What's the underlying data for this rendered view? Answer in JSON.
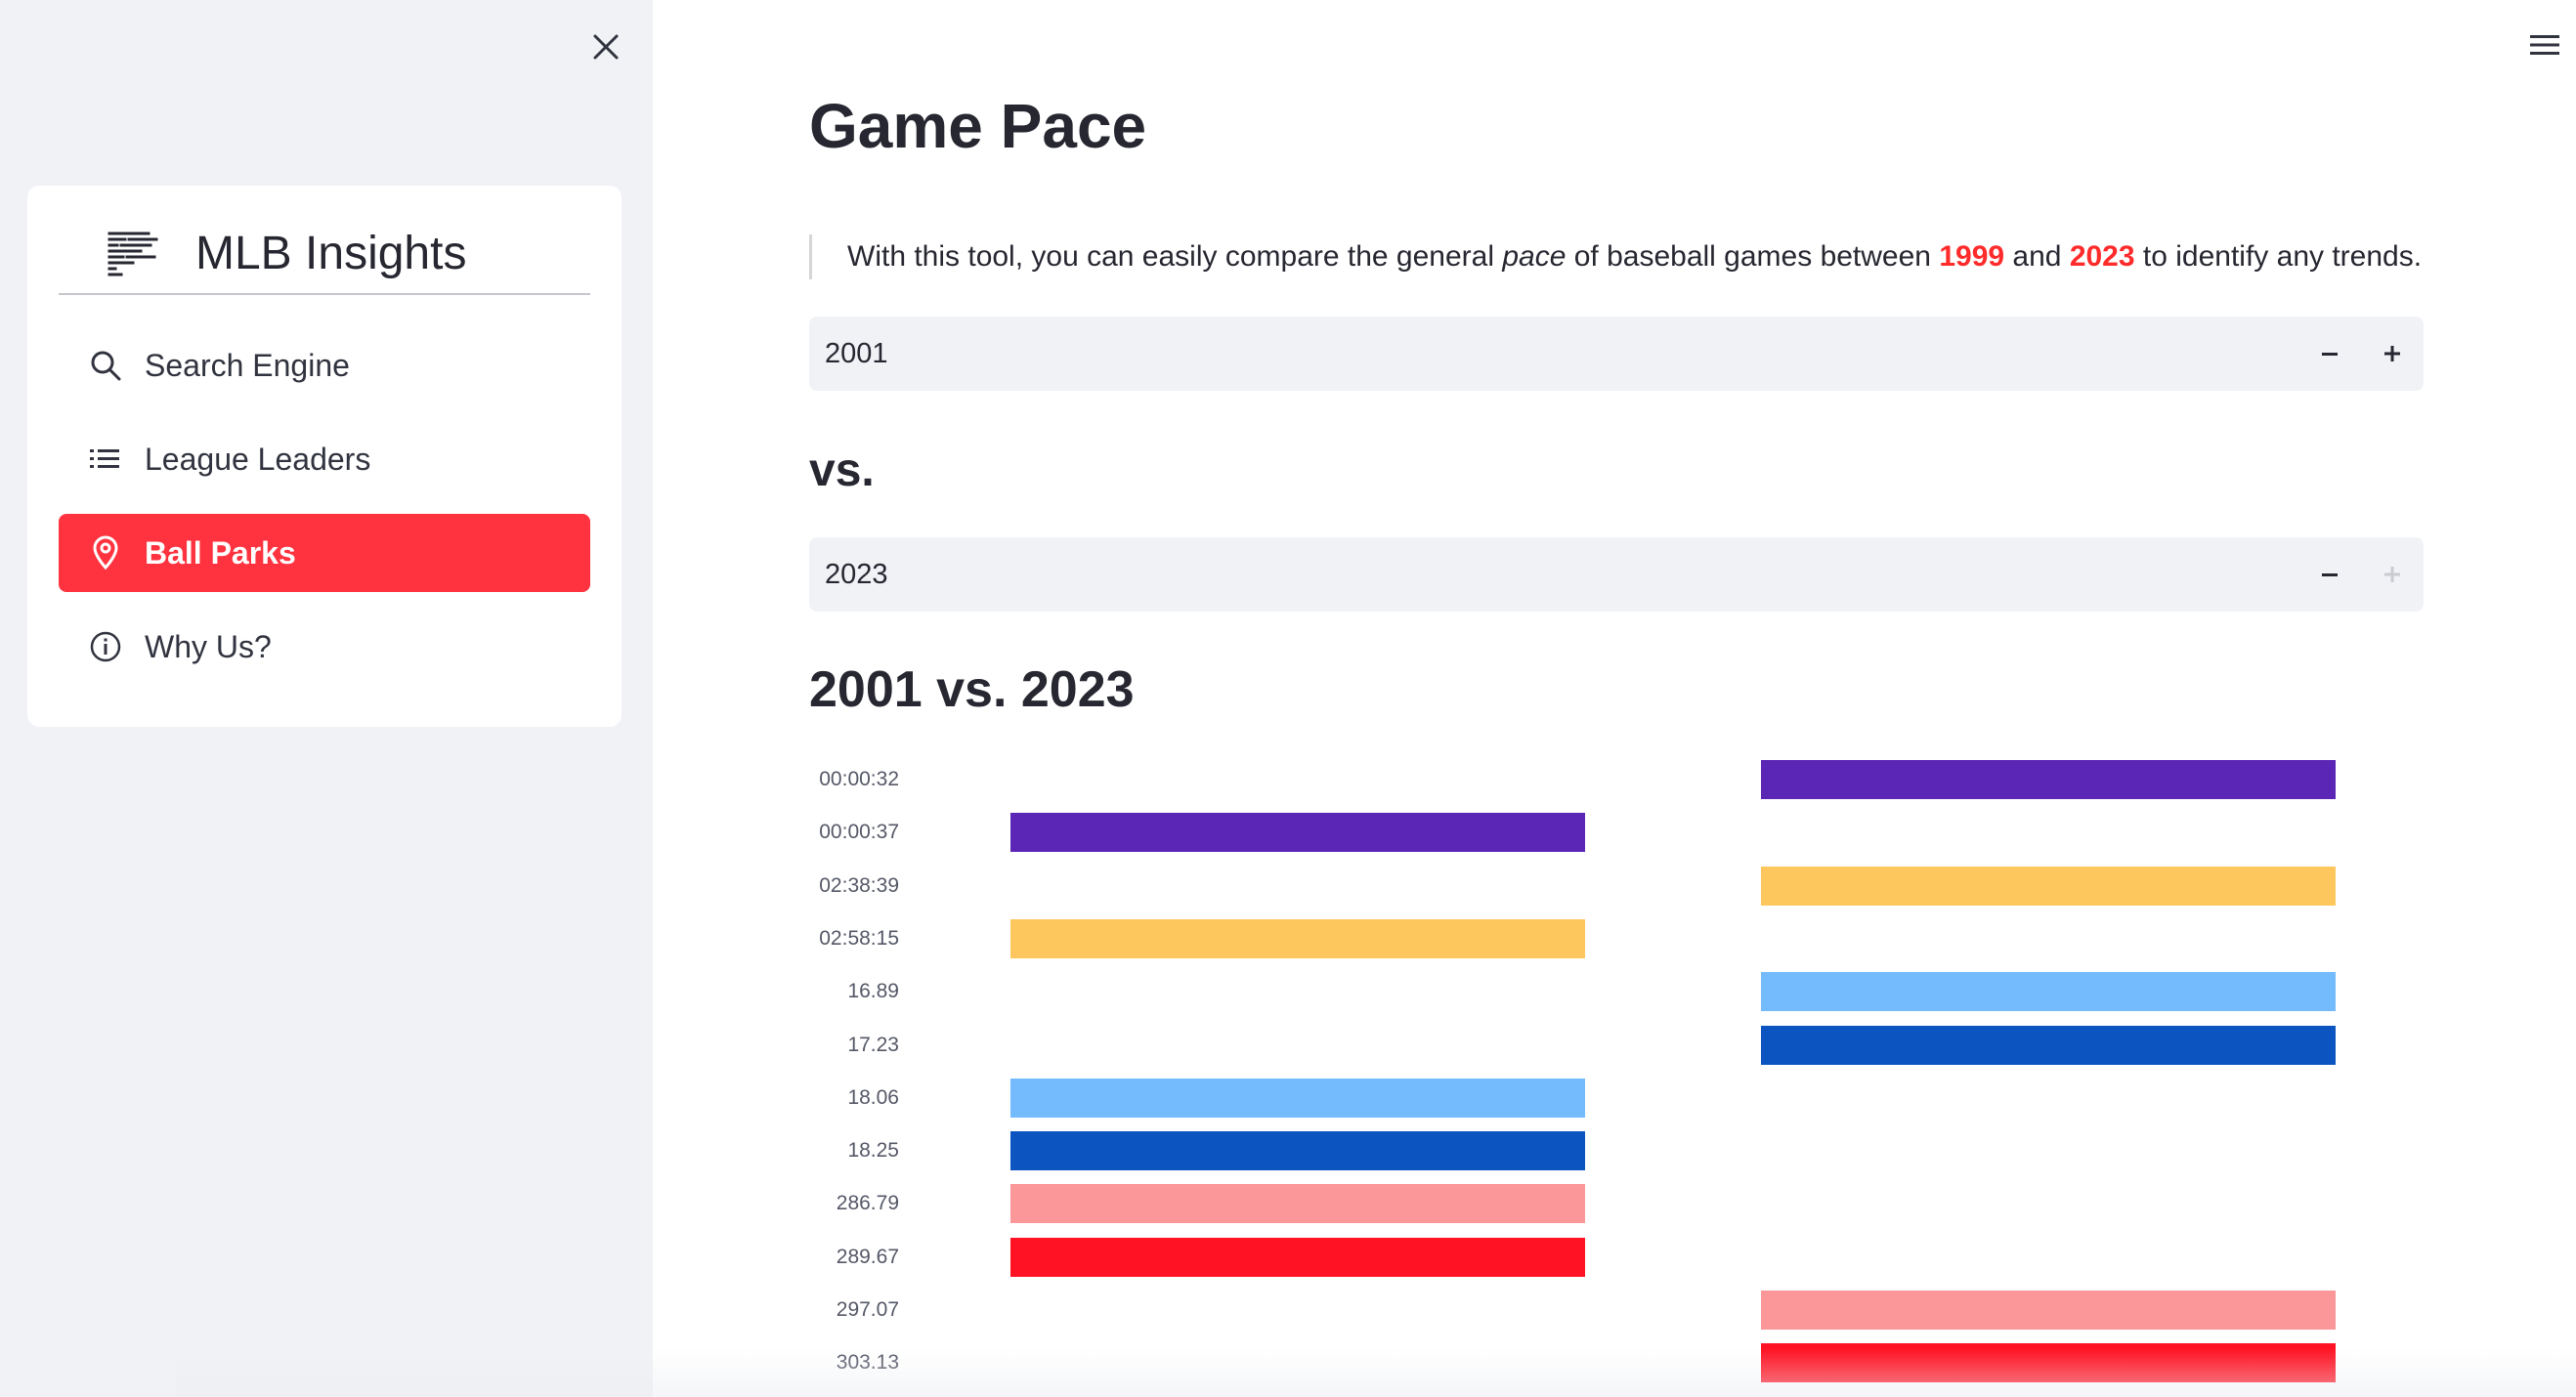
{
  "sidebar": {
    "app_title": "MLB Insights",
    "items": [
      {
        "label": "Search Engine",
        "icon": "search-icon",
        "active": false
      },
      {
        "label": "League Leaders",
        "icon": "list-icon",
        "active": false
      },
      {
        "label": "Ball Parks",
        "icon": "map-pin-icon",
        "active": true
      },
      {
        "label": "Why Us?",
        "icon": "info-icon",
        "active": false
      }
    ]
  },
  "main": {
    "title": "Game Pace",
    "intro": {
      "before": "With this tool, you can easily compare the general ",
      "emphasis": "pace",
      "middle": " of baseball games between ",
      "year_start": "1999",
      "and": " and ",
      "year_end": "2023",
      "after": " to identify any trends."
    },
    "stepper_1": {
      "value": "2001",
      "minus": "−",
      "plus": "+"
    },
    "vs_label": "vs.",
    "stepper_2": {
      "value": "2023",
      "minus": "−",
      "plus": "+"
    },
    "comparison_title": "2001 vs. 2023"
  },
  "colors": {
    "accent": "#ff333f",
    "highlight": "#ff2b2b",
    "sidebar_bg": "#f0f2f6"
  },
  "chart_data": {
    "type": "bar",
    "categories": [
      "00:00:32",
      "00:00:37",
      "02:38:39",
      "02:58:15",
      "16.89",
      "17.23",
      "18.06",
      "18.25",
      "286.79",
      "289.67",
      "297.07",
      "303.13"
    ],
    "series": [
      {
        "values": [
          null,
          1,
          null,
          1,
          null,
          null,
          1,
          1,
          1,
          1,
          null,
          null
        ],
        "colors": [
          null,
          "#5b25b5",
          null,
          "#fec75d",
          null,
          null,
          "#73bbfd",
          "#0c54bf",
          "#fb9699",
          "#ff1223",
          null,
          null
        ]
      },
      {
        "values": [
          1,
          null,
          1,
          null,
          1,
          1,
          null,
          null,
          null,
          null,
          1,
          1
        ],
        "colors": [
          "#5b25b5",
          null,
          "#fec75d",
          null,
          "#73bbfd",
          "#0c54bf",
          null,
          null,
          null,
          null,
          "#fb9699",
          "#ff1223"
        ]
      }
    ]
  }
}
